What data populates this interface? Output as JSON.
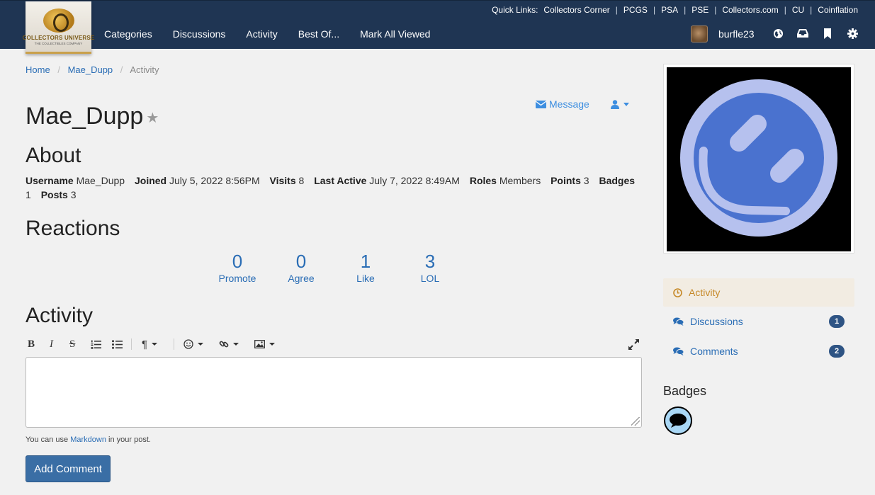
{
  "logo": {
    "line1": "COLLECTORS UNIVERSE",
    "line2": "THE COLLECTIBLES COMPANY"
  },
  "quicklinks": {
    "label": "Quick Links:",
    "items": [
      "Collectors Corner",
      "PCGS",
      "PSA",
      "PSE",
      "Collectors.com",
      "CU",
      "Coinflation"
    ]
  },
  "nav": [
    "Categories",
    "Discussions",
    "Activity",
    "Best Of...",
    "Mark All Viewed"
  ],
  "user": {
    "name": "burfle23"
  },
  "header_icons": [
    "globe-icon",
    "inbox-icon",
    "bookmark-icon",
    "gear-icon"
  ],
  "breadcrumb": [
    "Home",
    "Mae_Dupp",
    "Activity"
  ],
  "profile": {
    "name": "Mae_Dupp",
    "star": "★",
    "message_label": "Message"
  },
  "about": {
    "title": "About",
    "fields": [
      {
        "label": "Username",
        "value": "Mae_Dupp"
      },
      {
        "label": "Joined",
        "value": "July 5, 2022 8:56PM"
      },
      {
        "label": "Visits",
        "value": "8"
      },
      {
        "label": "Last Active",
        "value": "July 7, 2022 8:49AM"
      },
      {
        "label": "Roles",
        "value": "Members"
      },
      {
        "label": "Points",
        "value": "3"
      },
      {
        "label": "Badges",
        "value": "1"
      },
      {
        "label": "Posts",
        "value": "3"
      }
    ]
  },
  "reactions": {
    "title": "Reactions",
    "items": [
      {
        "count": "0",
        "label": "Promote"
      },
      {
        "count": "0",
        "label": "Agree"
      },
      {
        "count": "1",
        "label": "Like"
      },
      {
        "count": "3",
        "label": "LOL"
      }
    ]
  },
  "activity": {
    "title": "Activity",
    "hint_prefix": "You can use ",
    "hint_link": "Markdown",
    "hint_suffix": " in your post.",
    "submit_label": "Add Comment"
  },
  "side_nav": [
    {
      "label": "Activity",
      "count": "",
      "active": true
    },
    {
      "label": "Discussions",
      "count": "1"
    },
    {
      "label": "Comments",
      "count": "2"
    }
  ],
  "badges": {
    "title": "Badges"
  },
  "colors": {
    "header_bg": "#1f3553",
    "link": "#2a6db5",
    "active": "#c68a2a",
    "button": "#3a6ea5",
    "avatar_outer": "#b6c1ee",
    "avatar_inner": "#4a72cf"
  }
}
